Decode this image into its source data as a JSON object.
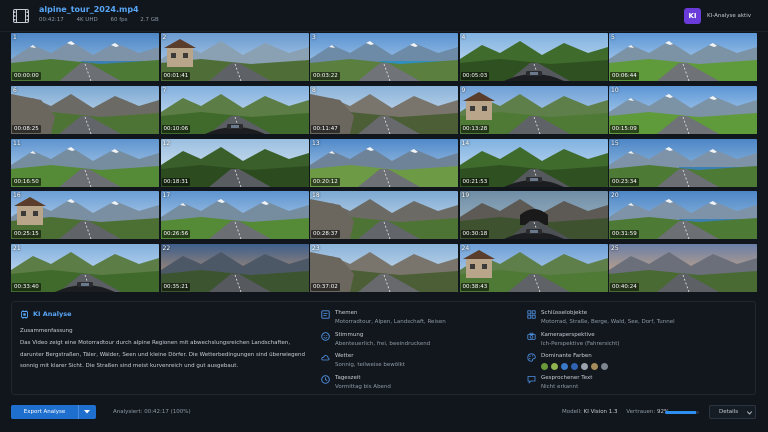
{
  "header": {
    "file_name": "alpine_tour_2024.mp4",
    "duration": "00:42:17",
    "resolution": "4K UHD",
    "fps": "60 fps",
    "size": "2.7 GB",
    "ai_badge": "KI",
    "ai_status": "KI-Analyse aktiv",
    "film_icon": "film-strip-icon"
  },
  "thumbnails": [
    {
      "num": "1",
      "time": "00:00:00",
      "scene": "lake-mountains"
    },
    {
      "num": "2",
      "time": "00:01:41",
      "scene": "village-road"
    },
    {
      "num": "3",
      "time": "00:03:22",
      "scene": "lake-road"
    },
    {
      "num": "4",
      "time": "00:05:03",
      "scene": "handlebar-forest"
    },
    {
      "num": "5",
      "time": "00:06:44",
      "scene": "green-valley"
    },
    {
      "num": "6",
      "time": "00:08:25",
      "scene": "cliff-road"
    },
    {
      "num": "7",
      "time": "00:10:06",
      "scene": "handlebar-curve"
    },
    {
      "num": "8",
      "time": "00:11:47",
      "scene": "rock-wall"
    },
    {
      "num": "9",
      "time": "00:13:28",
      "scene": "village-flowers"
    },
    {
      "num": "10",
      "time": "00:15:09",
      "scene": "green-valley"
    },
    {
      "num": "11",
      "time": "00:16:50",
      "scene": "valley-road"
    },
    {
      "num": "12",
      "time": "00:18:31",
      "scene": "forest-road"
    },
    {
      "num": "13",
      "time": "00:20:12",
      "scene": "mountain-pass"
    },
    {
      "num": "14",
      "time": "00:21:53",
      "scene": "handlebar-forest"
    },
    {
      "num": "15",
      "time": "00:23:34",
      "scene": "lake-mountains"
    },
    {
      "num": "16",
      "time": "00:25:15",
      "scene": "chalet-road"
    },
    {
      "num": "17",
      "time": "00:26:56",
      "scene": "valley-road"
    },
    {
      "num": "18",
      "time": "00:28:37",
      "scene": "cliff-road"
    },
    {
      "num": "19",
      "time": "00:30:18",
      "scene": "tunnel"
    },
    {
      "num": "20",
      "time": "00:31:59",
      "scene": "lake-mountains"
    },
    {
      "num": "21",
      "time": "00:33:40",
      "scene": "handlebar-curve"
    },
    {
      "num": "22",
      "time": "00:35:21",
      "scene": "dusk-road"
    },
    {
      "num": "23",
      "time": "00:37:02",
      "scene": "rock-wall"
    },
    {
      "num": "24",
      "time": "00:38:43",
      "scene": "village-flowers"
    },
    {
      "num": "25",
      "time": "00:40:24",
      "scene": "sunset-road"
    }
  ],
  "analysis": {
    "title": "KI Analyse",
    "summary_label": "Zusammenfassung",
    "summary_text": "Das Video zeigt eine Motorradtour durch alpine Regionen mit abwechslungsreichen Landschaften, darunter Bergstraßen, Täler, Wälder, Seen und kleine Dörfer. Die Wetterbedingungen sind überwiegend sonnig mit klarer Sicht. Die Straßen sind meist kurvenreich und gut ausgebaut.",
    "themes_label": "Themen",
    "themes_value": "Motorradtour, Alpen, Landschaft, Reisen",
    "mood_label": "Stimmung",
    "mood_value": "Abenteuerlich, frei, beeindruckend",
    "weather_label": "Wetter",
    "weather_value": "Sonnig, teilweise bewölkt",
    "daytime_label": "Tageszeit",
    "daytime_value": "Vormittag bis Abend",
    "keyobjects_label": "Schlüsselobjekte",
    "keyobjects_value": "Motorrad, Straße, Berge, Wald, See, Dorf, Tunnel",
    "perspective_label": "Kameraperspektive",
    "perspective_value": "Ich-Perspektive (Fahrersicht)",
    "colors_label": "Dominante Farben",
    "colors": [
      "#6b9a3a",
      "#8fb44f",
      "#3a78c8",
      "#2f62b0",
      "#9aa3ad",
      "#a58a5a",
      "#7d8590"
    ],
    "speech_label": "Gesprochener Text",
    "speech_value": "Nicht erkannt"
  },
  "footer": {
    "export_label": "Export Analyse",
    "analysed_label": "Analysiert:",
    "analysed_value": "00:42:17 (100%)",
    "model_label": "Modell:",
    "model_value": "KI Vision 1.3",
    "confidence_label": "Vertrauen:",
    "confidence_value": "92%",
    "confidence": 0.92,
    "details_label": "Details"
  }
}
